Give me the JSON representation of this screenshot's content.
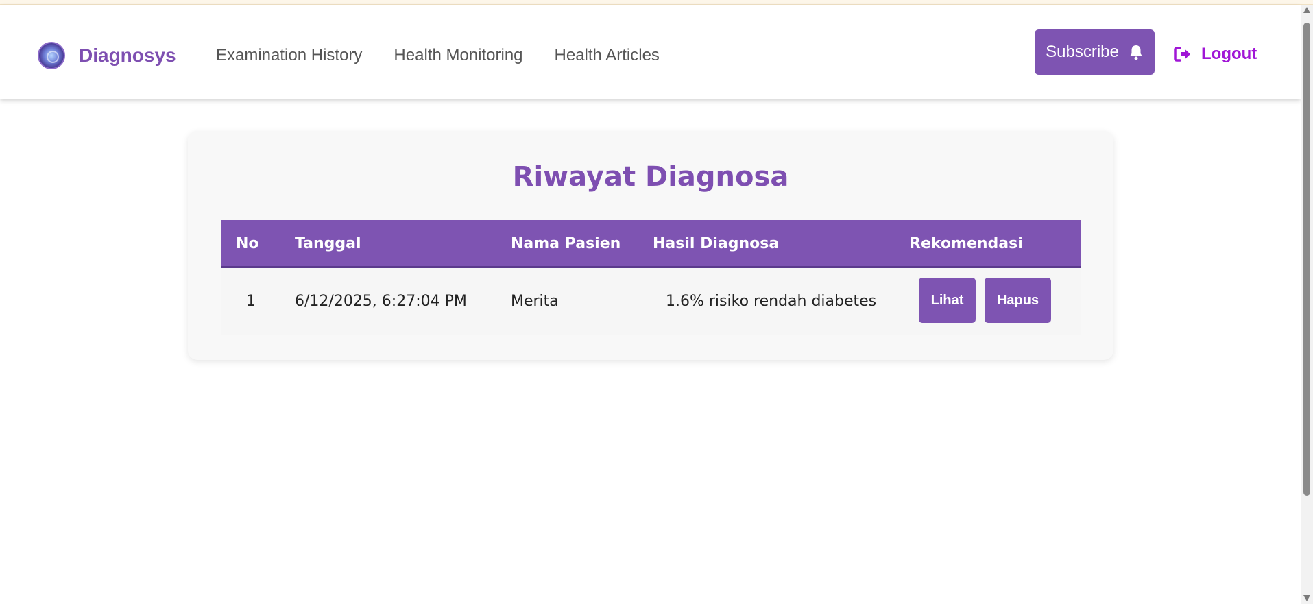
{
  "brand": {
    "name": "Diagnosys",
    "logo_icon": "brain-globe-logo-icon"
  },
  "nav": {
    "links": [
      {
        "label": "Examination History"
      },
      {
        "label": "Health Monitoring"
      },
      {
        "label": "Health Articles"
      }
    ],
    "subscribe_label": "Subscribe",
    "subscribe_icon": "bell-icon",
    "logout_label": "Logout",
    "logout_icon": "sign-out-icon"
  },
  "colors": {
    "accent": "#7e54b2",
    "brand_text": "#7e4fb1",
    "logout": "#a016d6"
  },
  "main": {
    "title": "Riwayat Diagnosa",
    "table": {
      "headers": [
        "No",
        "Tanggal",
        "Nama Pasien",
        "Hasil Diagnosa",
        "Rekomendasi"
      ],
      "rows": [
        {
          "no": "1",
          "tanggal": "6/12/2025, 6:27:04 PM",
          "nama_pasien": "Merita",
          "hasil_diagnosa": "1.6% risiko rendah diabetes",
          "actions": {
            "view_label": "Lihat",
            "delete_label": "Hapus"
          }
        }
      ]
    }
  }
}
